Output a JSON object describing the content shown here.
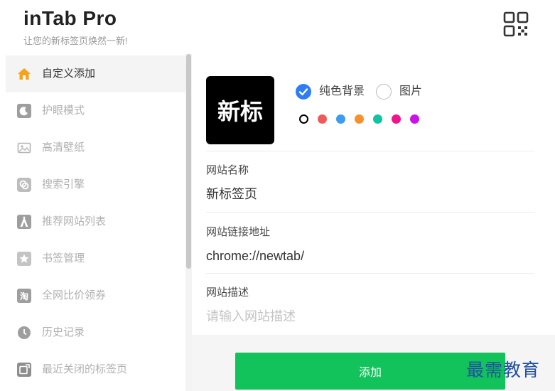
{
  "header": {
    "title": "inTab Pro",
    "subtitle": "让您的新标签页焕然一新!",
    "qr_icon": "qr-code-icon"
  },
  "sidebar": {
    "items": [
      {
        "label": "自定义添加",
        "icon": "home-icon",
        "active": true
      },
      {
        "label": "护眼模式",
        "icon": "moon-icon"
      },
      {
        "label": "高清壁纸",
        "icon": "image-icon"
      },
      {
        "label": "搜索引擎",
        "icon": "search-engine-icon"
      },
      {
        "label": "推荐网站列表",
        "icon": "recommend-icon"
      },
      {
        "label": "书签管理",
        "icon": "star-icon"
      },
      {
        "label": "全网比价领券",
        "icon": "coupon-icon"
      },
      {
        "label": "历史记录",
        "icon": "history-icon"
      },
      {
        "label": "最近关闭的标签页",
        "icon": "recent-tab-icon"
      }
    ]
  },
  "editor": {
    "preview_text": "新标",
    "background_options": [
      {
        "label": "纯色背景",
        "checked": true
      },
      {
        "label": "图片",
        "checked": false
      }
    ],
    "colors": [
      "#000000",
      "#f05a5a",
      "#3d9cf0",
      "#f7922a",
      "#12c2a0",
      "#f0148c",
      "#c814e6"
    ],
    "selected_color": "#000000",
    "fields": {
      "name": {
        "label": "网站名称",
        "value": "新标签页"
      },
      "url": {
        "label": "网站链接地址",
        "value": "chrome://newtab/"
      },
      "desc": {
        "label": "网站描述",
        "value": "",
        "placeholder": "请输入网站描述"
      }
    },
    "add_button": "添加"
  },
  "watermark": "最需教育"
}
